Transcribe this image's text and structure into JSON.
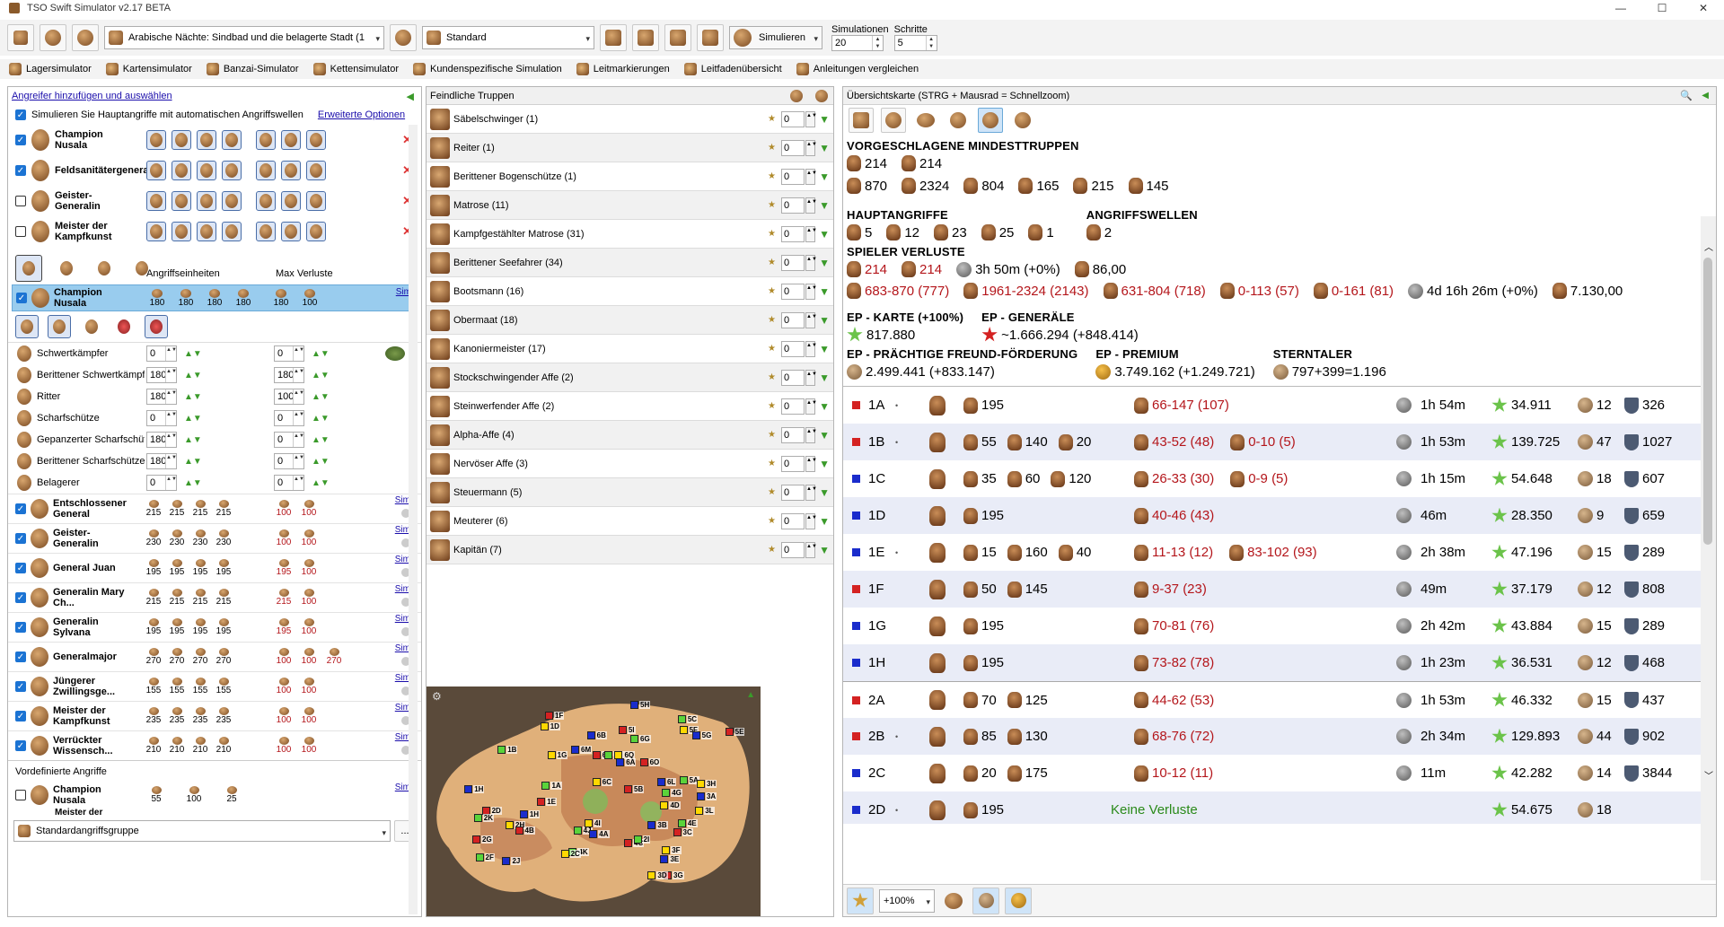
{
  "window": {
    "title": "TSO Swift Simulator v2.17 BETA",
    "min": "—",
    "max": "☐",
    "close": "✕"
  },
  "toolbar": {
    "adventure": "Arabische Nächte: Sindbad und die belagerte Stadt (1",
    "preset": "Standard",
    "simulate": "Simulieren",
    "sim_label": "Simulationen",
    "sim_value": "20",
    "steps_label": "Schritte",
    "steps_value": "5"
  },
  "tabs": [
    "Lagersimulator",
    "Kartensimulator",
    "Banzai-Simulator",
    "Kettensimulator",
    "Kundenspezifische Simulation",
    "Leitmarkierungen",
    "Leitfadenübersicht",
    "Anleitungen vergleichen"
  ],
  "left": {
    "header": "Angreifer hinzufügen und auswählen",
    "main_chk": "Simulieren Sie Hauptangriffe mit automatischen Angriffswellen",
    "advanced": "Erweiterte Optionen",
    "gens": [
      {
        "name": "Champion Nusala",
        "on": true
      },
      {
        "name": "Feldsanitätergeneral",
        "on": true
      },
      {
        "name": "Geister-Generalin",
        "on": false
      },
      {
        "name": "Meister der Kampfkunst",
        "on": false
      }
    ],
    "col_units": "Angriffseinheiten",
    "col_loss": "Max Verluste",
    "sel_name": "Champion Nusala",
    "sel_vals": [
      "180",
      "180",
      "180",
      "180"
    ],
    "sel_loss": [
      "180",
      "100"
    ],
    "sim": "Sim",
    "units": [
      {
        "n": "Schwertkämpfer",
        "v": "0",
        "m": "0"
      },
      {
        "n": "Berittener Schwertkämpfer",
        "v": "180",
        "m": "180"
      },
      {
        "n": "Ritter",
        "v": "180",
        "m": "100"
      },
      {
        "n": "Scharfschütze",
        "v": "0",
        "m": "0"
      },
      {
        "n": "Gepanzerter Scharfschütze",
        "v": "180",
        "m": "0"
      },
      {
        "n": "Berittener Scharfschütze",
        "v": "180",
        "m": "0"
      },
      {
        "n": "Belagerer",
        "v": "0",
        "m": "0"
      }
    ],
    "list": [
      {
        "n": "Entschlossener General",
        "v": [
          "215",
          "215",
          "215",
          "215"
        ],
        "l": [
          "100",
          "100"
        ]
      },
      {
        "n": "Geister-Generalin",
        "v": [
          "230",
          "230",
          "230",
          "230"
        ],
        "l": [
          "100",
          "100"
        ]
      },
      {
        "n": "General Juan",
        "v": [
          "195",
          "195",
          "195",
          "195"
        ],
        "l": [
          "195",
          "100"
        ]
      },
      {
        "n": "Generalin Mary Ch...",
        "v": [
          "215",
          "215",
          "215",
          "215"
        ],
        "l": [
          "215",
          "100"
        ]
      },
      {
        "n": "Generalin Sylvana",
        "v": [
          "195",
          "195",
          "195",
          "195"
        ],
        "l": [
          "195",
          "100"
        ]
      },
      {
        "n": "Generalmajor",
        "v": [
          "270",
          "270",
          "270",
          "270"
        ],
        "l": [
          "100",
          "100",
          "270"
        ]
      },
      {
        "n": "Jüngerer Zwillingsge...",
        "v": [
          "155",
          "155",
          "155",
          "155"
        ],
        "l": [
          "100",
          "100"
        ]
      },
      {
        "n": "Meister der Kampfkunst",
        "v": [
          "235",
          "235",
          "235",
          "235"
        ],
        "l": [
          "100",
          "100"
        ]
      },
      {
        "n": "Verrückter Wissensch...",
        "v": [
          "210",
          "210",
          "210",
          "210"
        ],
        "l": [
          "100",
          "100"
        ]
      }
    ],
    "predef": "Vordefinierte Angriffe",
    "predef_item": {
      "n": "Champion Nusala",
      "v": [
        "55",
        "100",
        "25"
      ]
    },
    "predef_next": "Meister der",
    "group": "Standardangriffsgruppe",
    "more": "..."
  },
  "mid": {
    "header": "Feindliche Truppen",
    "rows": [
      "Säbelschwinger (1)",
      "Reiter (1)",
      "Berittener Bogenschütze (1)",
      "Matrose (11)",
      "Kampfgestählter Matrose (31)",
      "Berittener Seefahrer (34)",
      "Bootsmann (16)",
      "Obermaat (18)",
      "Kanoniermeister (17)",
      "Stockschwingender Affe (2)",
      "Steinwerfender Affe (2)",
      "Alpha-Affe (4)",
      "Nervöser Affe (3)",
      "Steuermann (5)",
      "Meuterer (6)",
      "Kapitän (7)"
    ],
    "val": "0"
  },
  "right": {
    "header": "Übersichtskarte  (STRG + Mausrad = Schnellzoom)",
    "min_title": "VORGESCHLAGENE MINDESTTRUPPEN",
    "min1": [
      "214",
      "214"
    ],
    "min2": [
      "870",
      "2324",
      "804",
      "165",
      "215",
      "145"
    ],
    "main_title": "HAUPTANGRIFFE",
    "main": [
      "5",
      "12",
      "23",
      "25",
      "1"
    ],
    "waves_title": "ANGRIFFSWELLEN",
    "waves": "2",
    "loss_title": "SPIELER VERLUSTE",
    "loss1": [
      "214",
      "214",
      "3h 50m (+0%)",
      "86,00"
    ],
    "loss2": [
      "683-870 (777)",
      "1961-2324 (2143)",
      "631-804 (718)",
      "0-113 (57)",
      "0-161 (81)",
      "4d 16h 26m (+0%)",
      "7.130,00"
    ],
    "ep_map_t": "EP - KARTE (+100%)",
    "ep_map": "817.880",
    "ep_gen_t": "EP - GENERÄLE",
    "ep_gen": "~1.666.294 (+848.414)",
    "ep_ff_t": "EP - PRÄCHTIGE FREUND-FÖRDERUNG",
    "ep_ff": "2.499.441 (+833.147)",
    "ep_pr_t": "EP - PREMIUM",
    "ep_pr": "3.749.162 (+1.249.721)",
    "st_t": "STERNTALER",
    "st": "797+399=1.196",
    "attacks": [
      {
        "id": "1A",
        "c": "#d42222",
        "u": [
          "195"
        ],
        "l": [
          "66-147 (107)"
        ],
        "t": "1h 54m",
        "ep": "34.911",
        "co": "12",
        "sh": "326",
        "dot": true
      },
      {
        "id": "1B",
        "c": "#d42222",
        "u": [
          "55",
          "140",
          "20"
        ],
        "l": [
          "43-52 (48)",
          "0-10 (5)"
        ],
        "t": "1h 53m",
        "ep": "139.725",
        "co": "47",
        "sh": "1027",
        "dot": true
      },
      {
        "id": "1C",
        "c": "#1a2ccc",
        "u": [
          "35",
          "60",
          "120"
        ],
        "l": [
          "26-33 (30)",
          "0-9 (5)"
        ],
        "t": "1h 15m",
        "ep": "54.648",
        "co": "18",
        "sh": "607"
      },
      {
        "id": "1D",
        "c": "#1a2ccc",
        "u": [
          "195"
        ],
        "l": [
          "40-46 (43)"
        ],
        "t": "46m",
        "ep": "28.350",
        "co": "9",
        "sh": "659"
      },
      {
        "id": "1E",
        "c": "#1a2ccc",
        "u": [
          "15",
          "160",
          "40"
        ],
        "l": [
          "11-13 (12)",
          "83-102 (93)"
        ],
        "t": "2h 38m",
        "ep": "47.196",
        "co": "15",
        "sh": "289",
        "dot": true
      },
      {
        "id": "1F",
        "c": "#d42222",
        "u": [
          "50",
          "145"
        ],
        "l": [
          "9-37 (23)"
        ],
        "t": "49m",
        "ep": "37.179",
        "co": "12",
        "sh": "808"
      },
      {
        "id": "1G",
        "c": "#1a2ccc",
        "u": [
          "195"
        ],
        "l": [
          "70-81 (76)"
        ],
        "t": "2h 42m",
        "ep": "43.884",
        "co": "15",
        "sh": "289"
      },
      {
        "id": "1H",
        "c": "#1a2ccc",
        "u": [
          "195"
        ],
        "l": [
          "73-82 (78)"
        ],
        "t": "1h 23m",
        "ep": "36.531",
        "co": "12",
        "sh": "468"
      },
      {
        "id": "2A",
        "c": "#d42222",
        "u": [
          "70",
          "125"
        ],
        "l": [
          "44-62 (53)"
        ],
        "t": "1h 53m",
        "ep": "46.332",
        "co": "15",
        "sh": "437"
      },
      {
        "id": "2B",
        "c": "#d42222",
        "u": [
          "85",
          "130"
        ],
        "l": [
          "68-76 (72)"
        ],
        "t": "2h 34m",
        "ep": "129.893",
        "co": "44",
        "sh": "902",
        "dot": true
      },
      {
        "id": "2C",
        "c": "#1a2ccc",
        "u": [
          "20",
          "175"
        ],
        "l": [
          "10-12 (11)"
        ],
        "t": "11m",
        "ep": "42.282",
        "co": "14",
        "sh": "3844"
      },
      {
        "id": "2D",
        "c": "#1a2ccc",
        "u": [
          "195"
        ],
        "l": [
          "Keine Verluste"
        ],
        "t": "",
        "ep": "54.675",
        "co": "18",
        "sh": "",
        "dot": true
      }
    ],
    "zoom": "+100%"
  },
  "map_markers": [
    "5H",
    "1F",
    "5C",
    "1D",
    "6B",
    "5I",
    "6G",
    "5F",
    "5G",
    "5E",
    "1B",
    "1G",
    "6M",
    "6N",
    "6J",
    "6Q",
    "6A",
    "6O",
    "1A",
    "6C",
    "6L",
    "5B",
    "5A",
    "3H",
    "1H",
    "1E",
    "4G",
    "4D",
    "3A",
    "2D",
    "2K",
    "2H",
    "1H",
    "4B",
    "4J",
    "4I",
    "4A",
    "4C",
    "4E",
    "3L",
    "2J",
    "2G",
    "4K",
    "3F",
    "3B",
    "3C",
    "2F",
    "2C",
    "3E",
    "3G",
    "2I",
    "3D"
  ]
}
